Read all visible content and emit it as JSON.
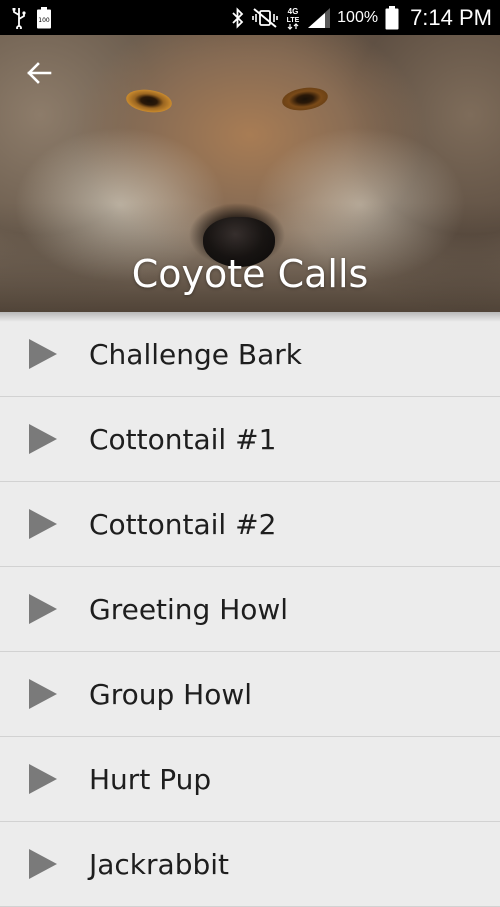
{
  "status_bar": {
    "battery_level_icon_text": "100",
    "battery_percent": "100%",
    "network": "4G",
    "time": "7:14 PM"
  },
  "header": {
    "title": "Coyote Calls"
  },
  "calls": [
    {
      "label": "Challenge Bark"
    },
    {
      "label": "Cottontail #1"
    },
    {
      "label": "Cottontail #2"
    },
    {
      "label": "Greeting Howl"
    },
    {
      "label": "Group Howl"
    },
    {
      "label": "Hurt Pup"
    },
    {
      "label": "Jackrabbit"
    }
  ]
}
